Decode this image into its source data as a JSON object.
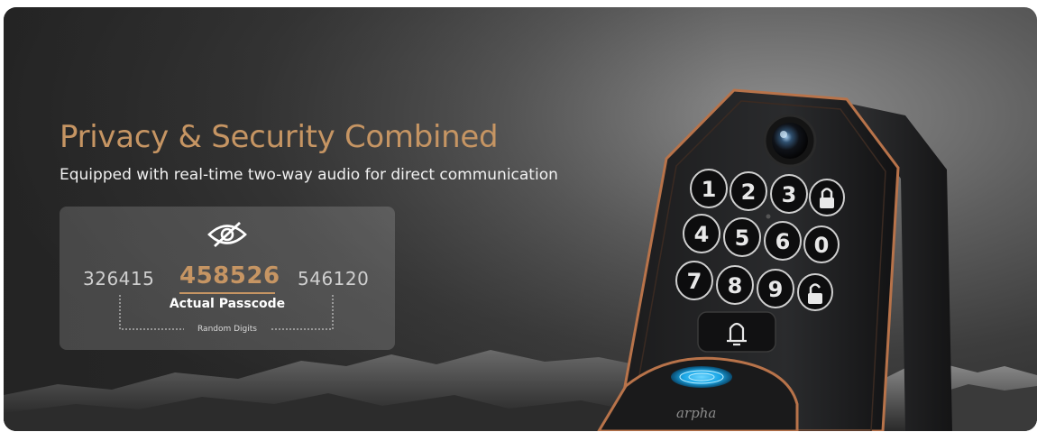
{
  "headline": "Privacy & Security Combined",
  "subline": "Equipped with real-time two-way audio for direct communication",
  "passcode": {
    "random_left": "326415",
    "actual": "458526",
    "random_right": "546120",
    "actual_label": "Actual Passcode",
    "random_label": "Random Digits"
  },
  "lock": {
    "keys": [
      "1",
      "2",
      "3",
      "4",
      "5",
      "6",
      "7",
      "8",
      "9",
      "0"
    ],
    "brand": "arpha"
  },
  "colors": {
    "accent": "#c69563",
    "text": "#f1f1f1",
    "fingerprint": "#19a6e6"
  }
}
